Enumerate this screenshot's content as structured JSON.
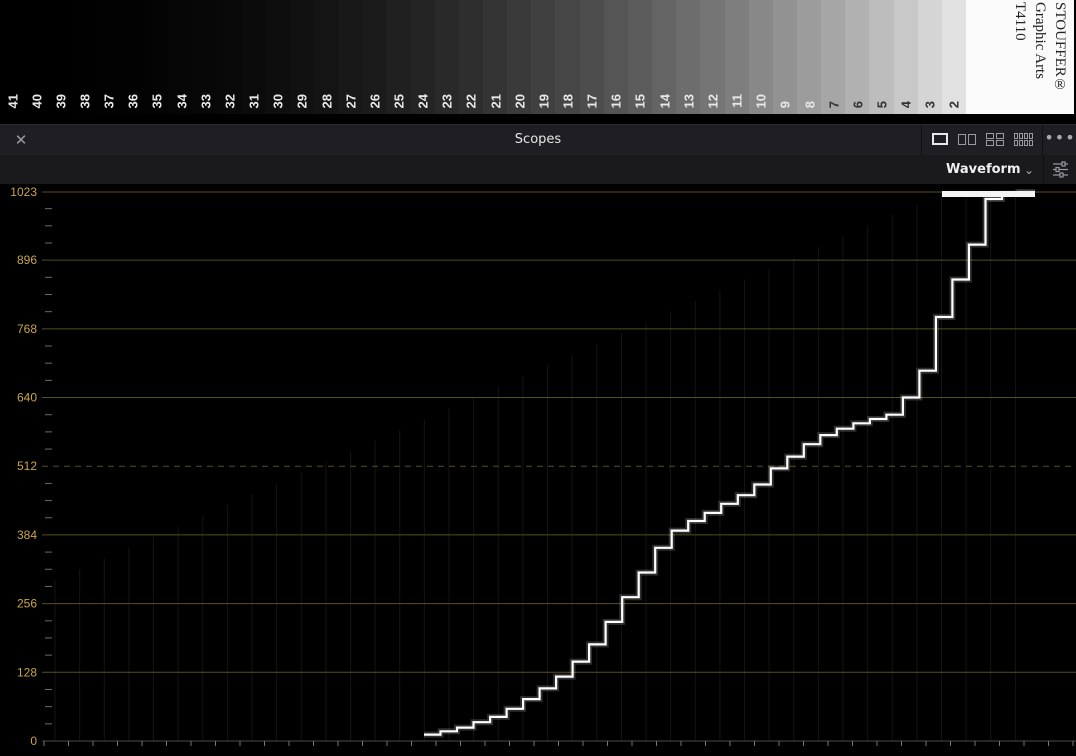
{
  "wedge": {
    "steps": [
      "41",
      "40",
      "39",
      "38",
      "37",
      "36",
      "35",
      "34",
      "33",
      "32",
      "31",
      "30",
      "29",
      "28",
      "27",
      "26",
      "25",
      "24",
      "23",
      "22",
      "21",
      "20",
      "19",
      "18",
      "17",
      "16",
      "15",
      "14",
      "13",
      "12",
      "11",
      "10",
      "9",
      "8",
      "7",
      "6",
      "5",
      "4",
      "3",
      "2"
    ],
    "label_lines": [
      "STOUFFER®",
      "Graphic Arts",
      "T4110"
    ]
  },
  "panel": {
    "title": "Scopes",
    "close_glyph": "✕",
    "more_glyph": "•••",
    "layouts": [
      "single-view",
      "dual-view",
      "quad-view",
      "four-column-view"
    ],
    "active_layout": "single-view"
  },
  "toolbar": {
    "mode": "Waveform",
    "chevron": "⌵",
    "settings_icon": "sliders-icon"
  },
  "scope": {
    "type": "waveform",
    "ymin": 0,
    "ymax": 1023,
    "y_ticks": [
      "0",
      "128",
      "256",
      "384",
      "512",
      "640",
      "768",
      "896",
      "1023"
    ],
    "y_tick_values": [
      0,
      128,
      256,
      384,
      512,
      640,
      768,
      896,
      1023
    ],
    "dashed_line_value": 512,
    "colors": {
      "label": "#c8a64a",
      "grid": "#5a4d22",
      "trace": "#ffffff"
    },
    "step_levels": [
      12,
      18,
      25,
      35,
      45,
      60,
      78,
      98,
      120,
      148,
      180,
      222,
      268,
      314,
      360,
      392,
      410,
      425,
      442,
      458,
      478,
      508,
      530,
      553,
      570,
      582,
      592,
      600,
      608,
      640,
      690,
      790,
      860,
      925,
      1010,
      1020,
      1023
    ]
  }
}
